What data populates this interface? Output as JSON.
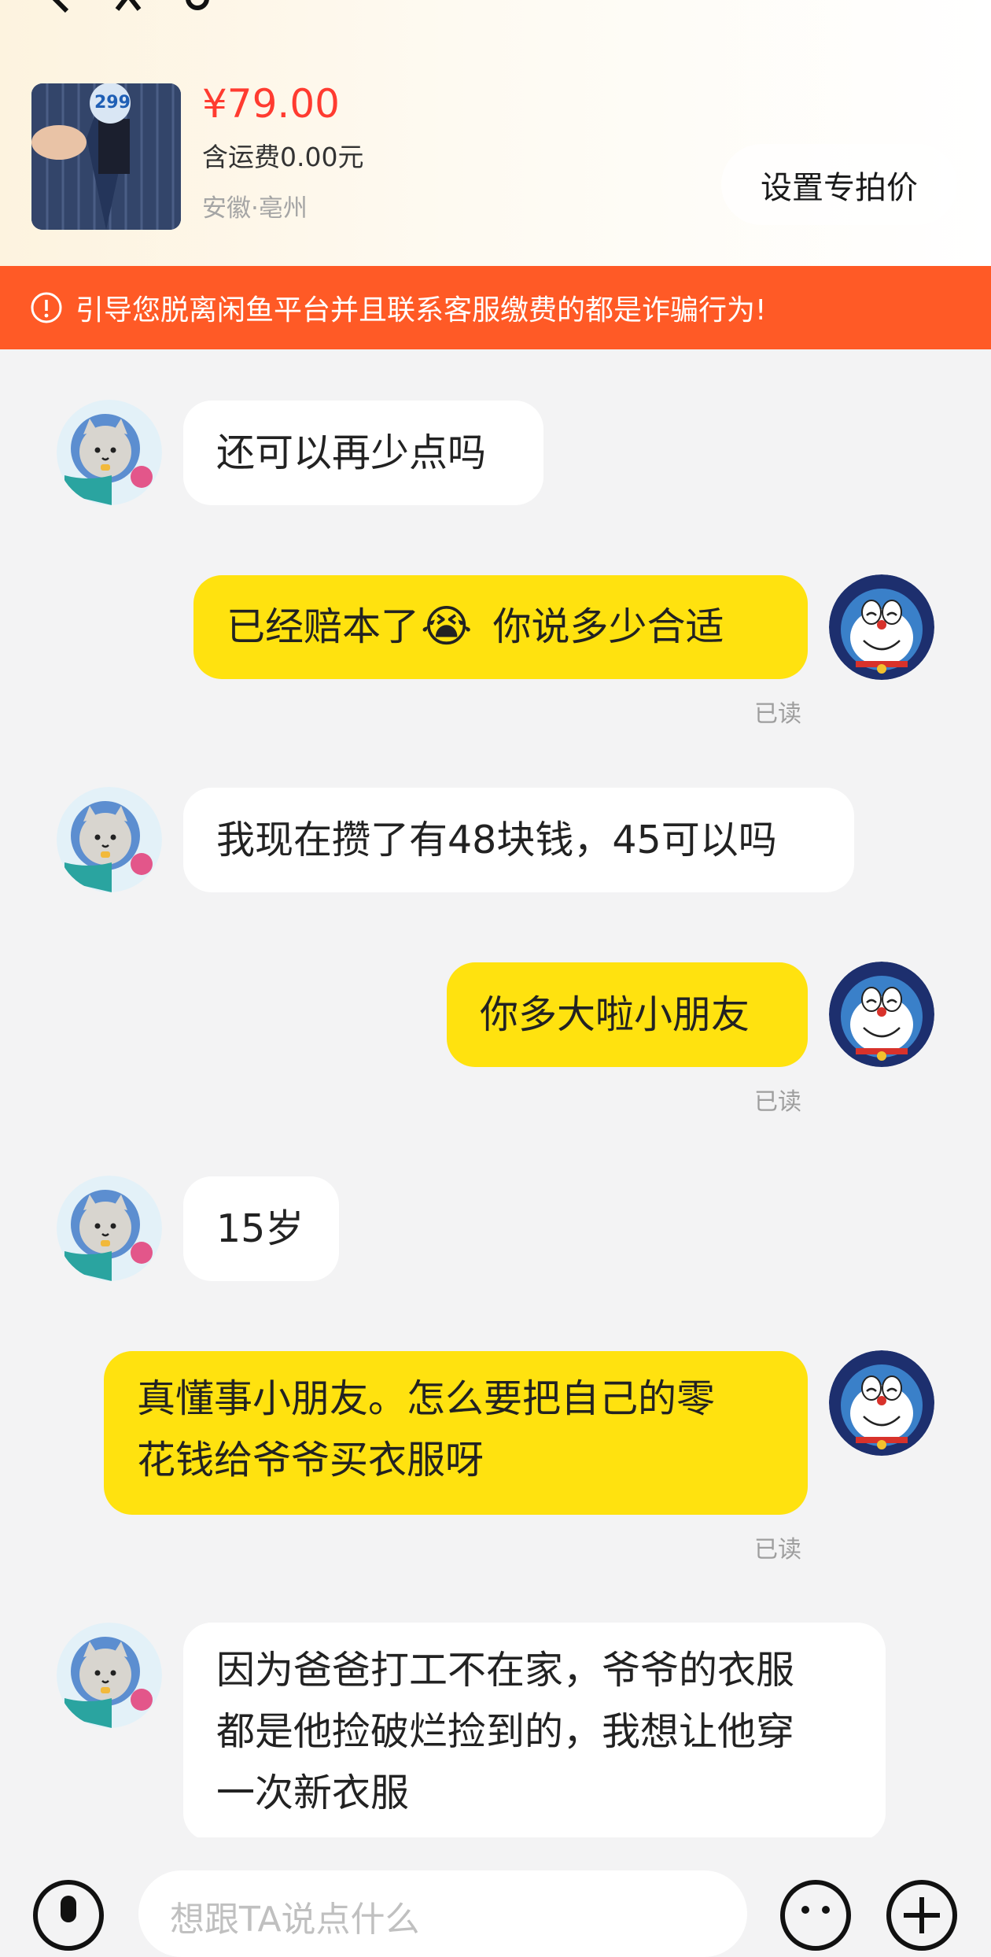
{
  "product": {
    "thumb_tag": "299",
    "price": "¥79.00",
    "shipping": "含运费0.00元",
    "location": "安徽·亳州"
  },
  "special_price_button": "设置专拍价",
  "warning": "引导您脱离闲鱼平台并且联系客服缴费的都是诈骗行为!",
  "messages": [
    {
      "side": "in",
      "text": "还可以再少点吗"
    },
    {
      "side": "out",
      "text_before": "已经赔本了",
      "emoji": "😭",
      "text_after": "你说多少合适",
      "read": "已读"
    },
    {
      "side": "in",
      "text": "我现在攒了有48块钱，45可以吗"
    },
    {
      "side": "out",
      "text": "你多大啦小朋友",
      "read": "已读"
    },
    {
      "side": "in",
      "text": "15岁"
    },
    {
      "side": "out",
      "line1": "真懂事小朋友。怎么要把自己的零",
      "line2": "花钱给爷爷买衣服呀",
      "read": "已读"
    },
    {
      "side": "in",
      "line1": "因为爸爸打工不在家，爷爷的衣服",
      "line2": "都是他捡破烂捡到的，我想让他穿",
      "line3": "一次新衣服"
    }
  ],
  "input": {
    "placeholder": "想跟TA说点什么"
  },
  "colors": {
    "accent": "#ff3b30",
    "warning_bg": "#ff5a26",
    "out_bubble": "#ffe20f"
  }
}
